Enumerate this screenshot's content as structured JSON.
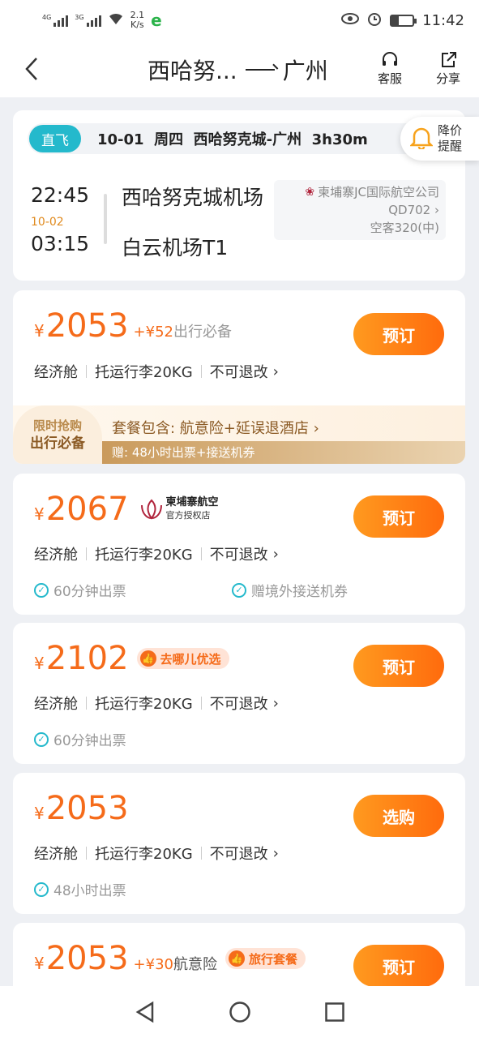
{
  "status_bar": {
    "net1": "4G",
    "net2": "3G",
    "speed_value": "2.1",
    "speed_unit": "K/s",
    "time": "11:42"
  },
  "nav": {
    "from": "西哈努...",
    "to": "广州",
    "service_label": "客服",
    "share_label": "分享"
  },
  "flight": {
    "direct_label": "直飞",
    "summary": "10-01  周四  西哈努克城-广州  3h30m",
    "remind_label_1": "降价",
    "remind_label_2": "提醒",
    "dep_time": "22:45",
    "arr_date": "10-02",
    "arr_time": "03:15",
    "dep_airport": "西哈努克城机场",
    "arr_airport": "白云机场T1",
    "airline": "柬埔寨JC国际航空公司",
    "flight_no": "QD702",
    "aircraft": "空客320(中)"
  },
  "offers": [
    {
      "price_symbol": "¥",
      "price": "2053",
      "extra_plus": "+¥52",
      "extra_text": "出行必备",
      "button": "预订",
      "cabin": "经济舱",
      "baggage": "托运行李20KG",
      "refund": "不可退改",
      "pkg_badge_1": "限时抢购",
      "pkg_badge_2": "出行必备",
      "pkg_line_1": "套餐包含: 航意险+延误退酒店",
      "pkg_line_2": "赠: 48小时出票+接送机券"
    },
    {
      "price_symbol": "¥",
      "price": "2067",
      "airline_tag_1": "柬埔寨航空",
      "airline_tag_2": "官方授权店",
      "button": "预订",
      "cabin": "经济舱",
      "baggage": "托运行李20KG",
      "refund": "不可退改",
      "check_1": "60分钟出票",
      "check_2": "赠境外接送机券"
    },
    {
      "price_symbol": "¥",
      "price": "2102",
      "tag": "去哪儿优选",
      "button": "预订",
      "cabin": "经济舱",
      "baggage": "托运行李20KG",
      "refund": "不可退改",
      "check_1": "60分钟出票"
    },
    {
      "price_symbol": "¥",
      "price": "2053",
      "button": "选购",
      "cabin": "经济舱",
      "baggage": "托运行李20KG",
      "refund": "不可退改",
      "check_1": "48小时出票"
    },
    {
      "price_symbol": "¥",
      "price": "2053",
      "extra_plus": "+¥30",
      "extra_text": "航意险",
      "tag": "旅行套餐",
      "button": "预订"
    }
  ],
  "colors": {
    "accent": "#f56b1a",
    "teal": "#24b9cc",
    "gold": "#8b5a24"
  }
}
